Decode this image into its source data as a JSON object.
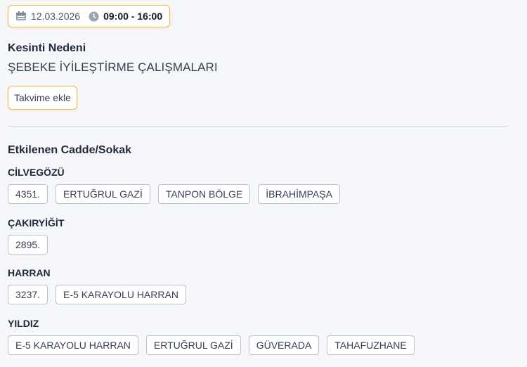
{
  "schedule": {
    "date": "12.03.2026",
    "time": "09:00 - 16:00"
  },
  "reason": {
    "label": "Kesinti Nedeni",
    "value": "ŞEBEKE İYİLEŞTİRME ÇALIŞMALARI"
  },
  "calendar_button": "Takvime ekle",
  "affected": {
    "title": "Etkilenen Cadde/Sokak",
    "districts": [
      {
        "name": "CİLVEGÖZÜ",
        "streets": [
          "4351.",
          "ERTUĞRUL GAZİ",
          "TANPON BÖLGE",
          "İBRAHİMPAŞA"
        ]
      },
      {
        "name": "ÇAKIRYİĞİT",
        "streets": [
          "2895."
        ]
      },
      {
        "name": "HARRAN",
        "streets": [
          "3237.",
          "E-5 KARAYOLU HARRAN"
        ]
      },
      {
        "name": "YILDIZ",
        "streets": [
          "E-5 KARAYOLU HARRAN",
          "ERTUĞRUL GAZİ",
          "GÜVERADA",
          "TAHAFUZHANE"
        ]
      }
    ]
  },
  "colors": {
    "accent": "#f2b94b",
    "background": "#f5f7fb",
    "tag_border": "#b8c0cc",
    "divider": "#d3d9e3"
  }
}
